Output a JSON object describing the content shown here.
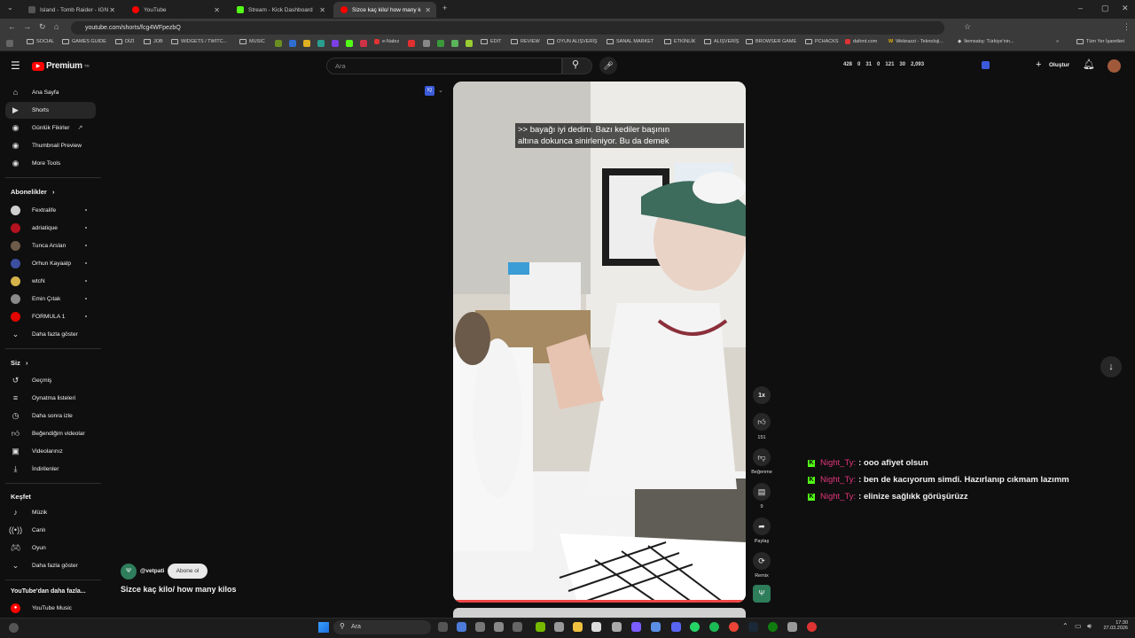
{
  "browser": {
    "tabs": [
      {
        "title": "Island - Tomb Raider - IGN",
        "color": "#3a3a3a"
      },
      {
        "title": "YouTube",
        "color": "#ff0000"
      },
      {
        "title": "Stream - Kick Dashboard",
        "color": "#53fc18"
      },
      {
        "title": "Sizce kaç kilo/ how many k...",
        "color": "#ff0000"
      }
    ],
    "url": "youtube.com/shorts/fcg4WFpezbQ",
    "bookmarks": [
      "SOCIAL",
      "GAMES GUIDE",
      "DİZİ",
      "JOB",
      "WIDGETS / TWITC...",
      "MUSIC",
      "e-Nabız",
      "EDIT",
      "REVIEW",
      "OYUN ALIŞVERİŞ",
      "SANAL MARKET",
      "ETKİNLİK",
      "ALIŞVERİŞ",
      "BROWSER GAME",
      "PCHACKS",
      "dafont.com",
      "Webrazzi - Teknoloji...",
      "İtemsatış: Türkiye'nin...",
      "Tüm Yer İşaretleri"
    ]
  },
  "youtube": {
    "logo": "Premium",
    "logo_sup": "TR",
    "search_placeholder": "Ara",
    "header_stats": [
      "428",
      "0",
      "31",
      "0",
      "121",
      "30",
      "2,093"
    ],
    "create_label": "Oluştur",
    "sidebar": {
      "main": [
        {
          "label": "Ana Sayfa",
          "icon": "home-icon"
        },
        {
          "label": "Shorts",
          "icon": "shorts-icon"
        },
        {
          "label": "Günlük Fikirler",
          "icon": "ext-icon"
        },
        {
          "label": "Thumbnail Preview",
          "icon": "ext-icon"
        },
        {
          "label": "More Tools",
          "icon": "ext-icon"
        }
      ],
      "subs_title": "Abonelikler",
      "subs": [
        {
          "label": "Fextralife",
          "color": "#cfcfcf"
        },
        {
          "label": "adriatique",
          "color": "#b3121e"
        },
        {
          "label": "Tunca Arslan",
          "color": "#6d5b4a"
        },
        {
          "label": "Orhun Kayaalp",
          "color": "#3b4fa0"
        },
        {
          "label": "wtcN",
          "color": "#d6b24a"
        },
        {
          "label": "Emin Çıtak",
          "color": "#8a8a8a"
        },
        {
          "label": "FORMULA 1",
          "color": "#e10600"
        }
      ],
      "subs_more": "Daha fazla göster",
      "you_title": "Siz",
      "you": [
        {
          "label": "Geçmiş",
          "icon": "history-icon"
        },
        {
          "label": "Oynatma listeleri",
          "icon": "playlist-icon"
        },
        {
          "label": "Daha sonra izle",
          "icon": "clock-icon"
        },
        {
          "label": "Beğendiğim videolar",
          "icon": "like-icon"
        },
        {
          "label": "Videolarınız",
          "icon": "video-icon"
        },
        {
          "label": "İndirilenler",
          "icon": "download-icon"
        }
      ],
      "explore_title": "Keşfet",
      "explore": [
        {
          "label": "Müzik",
          "icon": "music-icon"
        },
        {
          "label": "Canlı",
          "icon": "live-icon"
        },
        {
          "label": "Oyun",
          "icon": "game-icon"
        }
      ],
      "explore_more": "Daha fazla göster",
      "more_title": "YouTube'dan daha fazla...",
      "more": [
        {
          "label": "YouTube Music",
          "icon": "ytmusic-icon"
        }
      ]
    },
    "short": {
      "caption_line1": ">> bayağı iyi dedim. Bazı kediler başının",
      "caption_line2": "altına dokunca sinirleniyor. Bu da demek",
      "channel": "@vetpati",
      "subscribe": "Abone ol",
      "title": "Sizce kaç kilo/ how many kilos",
      "speed": "1x",
      "likes": "151",
      "dislike_label": "Beğenme",
      "comments": "9",
      "share_label": "Paylaş",
      "remix_label": "Remix"
    }
  },
  "chat": [
    {
      "user": "Night_Ty:",
      "message": ": ooo afiyet olsun"
    },
    {
      "user": "Night_Ty:",
      "message": ": ben de kacıyorum simdi. Hazırlanıp cıkmam lazımm"
    },
    {
      "user": "Night_Ty:",
      "message": ": elinize sağlıkk görüşürüzz"
    }
  ],
  "taskbar": {
    "search": "Ara",
    "time": "17:30",
    "date": "27.03.2026"
  }
}
